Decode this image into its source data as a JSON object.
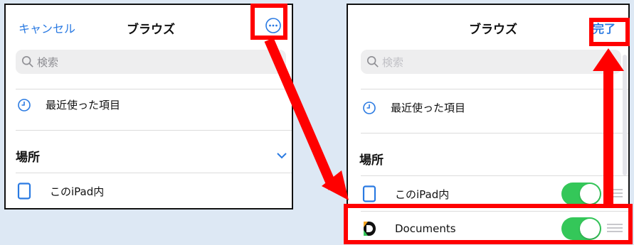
{
  "left": {
    "cancel": "キャンセル",
    "title": "ブラウズ",
    "search_placeholder": "検索",
    "recents": "最近使った項目",
    "locations_header": "場所",
    "ipad": "このiPad内"
  },
  "right": {
    "title": "ブラウズ",
    "done": "完了",
    "search_placeholder": "検索",
    "recents": "最近使った項目",
    "locations_header": "場所",
    "ipad": "このiPad内",
    "documents": "Documents"
  },
  "colors": {
    "accent": "#2a7ae2",
    "toggle_on": "#34c759",
    "highlight": "#ff0000",
    "background": "#dde8f4"
  },
  "icons": [
    "search-icon",
    "clock-icon",
    "ipad-icon",
    "more-icon",
    "chevron-down-icon",
    "documents-app-icon",
    "drag-handle-icon"
  ]
}
